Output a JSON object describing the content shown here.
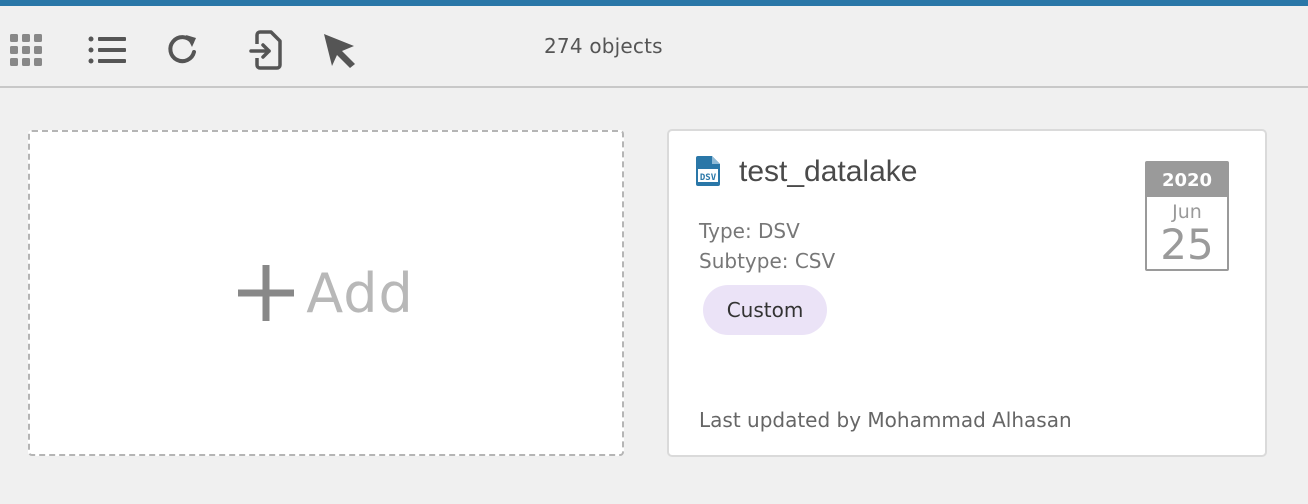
{
  "toolbar": {
    "object_count": "274 objects",
    "buttons": [
      {
        "icon": "grid-view-icon"
      },
      {
        "icon": "list-view-icon"
      },
      {
        "icon": "refresh-icon"
      },
      {
        "icon": "import-icon"
      },
      {
        "icon": "select-cursor-icon"
      }
    ]
  },
  "add_card": {
    "label": "Add"
  },
  "dataset": {
    "title": "test_datalake",
    "icon": "dsv-file-icon",
    "icon_text": "DSV",
    "type": "Type: DSV",
    "subtype": "Subtype: CSV",
    "tag": "Custom",
    "updated": "Last updated by Mohammad Alhasan",
    "date": {
      "year": "2020",
      "month": "Jun",
      "day": "25"
    }
  },
  "colors": {
    "accent": "#2a77a8",
    "tag_bg": "#ebe3f7",
    "icon_blue": "#2a77a8"
  }
}
